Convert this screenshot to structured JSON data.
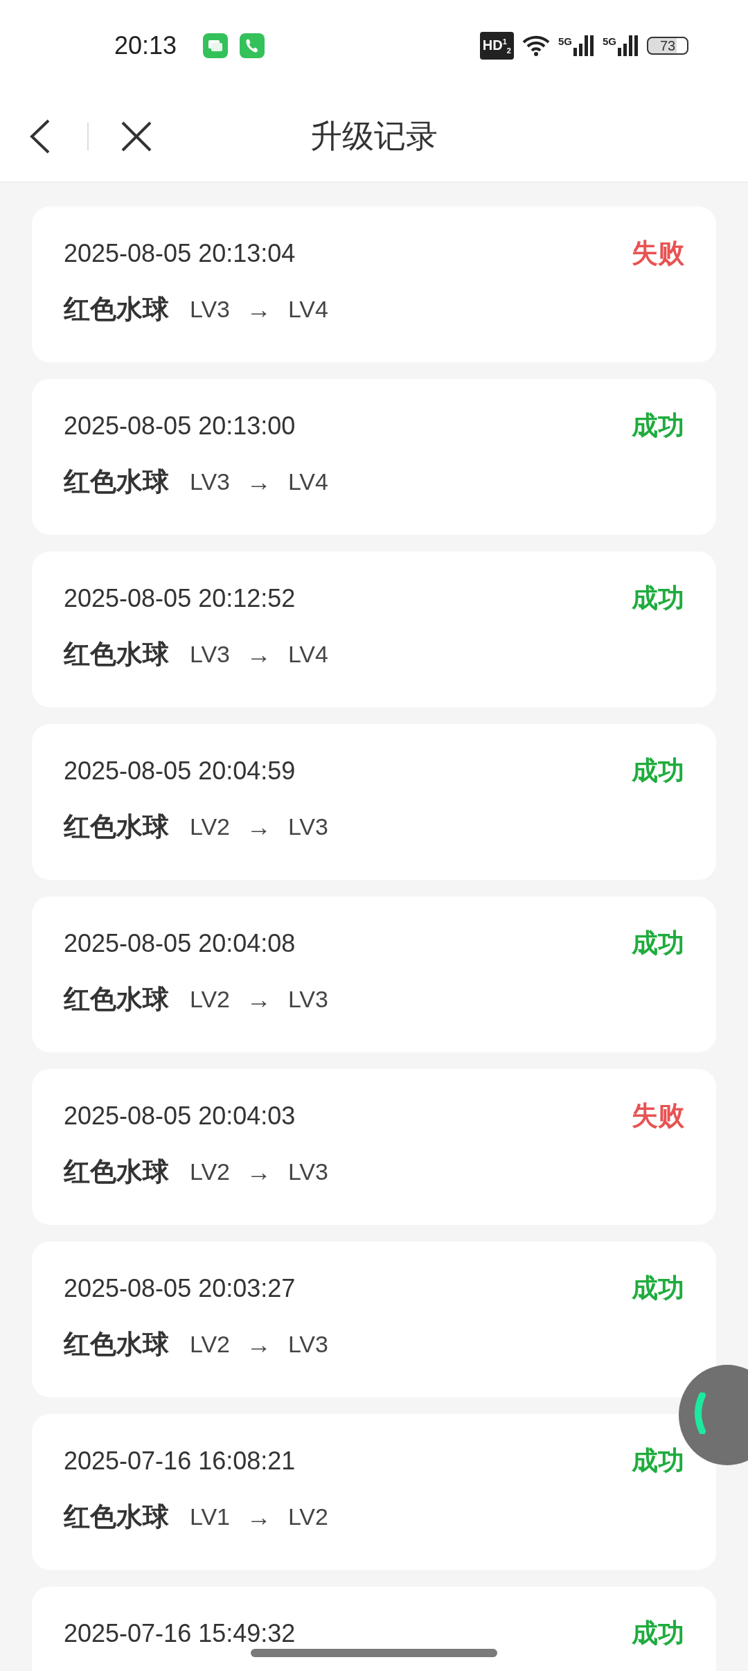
{
  "status_bar": {
    "time": "20:13",
    "hd": "HD$^{1}$$_{2}$",
    "networks": [
      "5G",
      "5G"
    ],
    "battery": "73"
  },
  "header": {
    "title": "升级记录"
  },
  "records": [
    {
      "time": "2025-08-05 20:13:04",
      "item": "红色水球",
      "from": "LV3",
      "arrow": "→",
      "to": "LV4",
      "kind": "fail",
      "status": "失败"
    },
    {
      "time": "2025-08-05 20:13:00",
      "item": "红色水球",
      "from": "LV3",
      "arrow": "→",
      "to": "LV4",
      "kind": "success",
      "status": "成功"
    },
    {
      "time": "2025-08-05 20:12:52",
      "item": "红色水球",
      "from": "LV3",
      "arrow": "→",
      "to": "LV4",
      "kind": "success",
      "status": "成功"
    },
    {
      "time": "2025-08-05 20:04:59",
      "item": "红色水球",
      "from": "LV2",
      "arrow": "→",
      "to": "LV3",
      "kind": "success",
      "status": "成功"
    },
    {
      "time": "2025-08-05 20:04:08",
      "item": "红色水球",
      "from": "LV2",
      "arrow": "→",
      "to": "LV3",
      "kind": "success",
      "status": "成功"
    },
    {
      "time": "2025-08-05 20:04:03",
      "item": "红色水球",
      "from": "LV2",
      "arrow": "→",
      "to": "LV3",
      "kind": "fail",
      "status": "失败"
    },
    {
      "time": "2025-08-05 20:03:27",
      "item": "红色水球",
      "from": "LV2",
      "arrow": "→",
      "to": "LV3",
      "kind": "success",
      "status": "成功"
    },
    {
      "time": "2025-07-16 16:08:21",
      "item": "红色水球",
      "from": "LV1",
      "arrow": "→",
      "to": "LV2",
      "kind": "success",
      "status": "成功"
    },
    {
      "time": "2025-07-16 15:49:32",
      "kind": "success",
      "status": "成功"
    }
  ]
}
